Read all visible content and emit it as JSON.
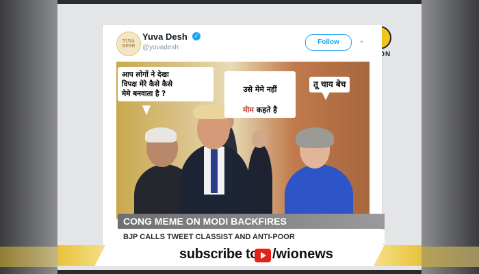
{
  "tweet": {
    "avatar_text": "YUVA DESH",
    "user_name": "Yuva Desh",
    "handle": "@yuvadesh",
    "follow_label": "Follow",
    "verified_icon": "verified-check-icon",
    "menu_icon": "chevron-down-icon"
  },
  "meme": {
    "bubble_left": "आप लोगों ने देखा\nविपक्ष मेरे कैसे कैसे\nमेमे बनवाता है ?",
    "bubble_center_line1": "उसे मेमे नहीं",
    "bubble_center_red": "मीम",
    "bubble_center_line2_rest": " कहते है",
    "bubble_right": "तू चाय बेच"
  },
  "lower_third": {
    "headline": "CONG MEME ON MODI BACKFIRES",
    "subheadline": "BJP CALLS TWEET CLASSIST AND ANTI-POOR"
  },
  "subscribe": {
    "text": "subscribe to",
    "channel": "/wionews",
    "icon": "youtube-icon"
  },
  "brand": {
    "name": "WION",
    "accent": "#f2c420"
  }
}
